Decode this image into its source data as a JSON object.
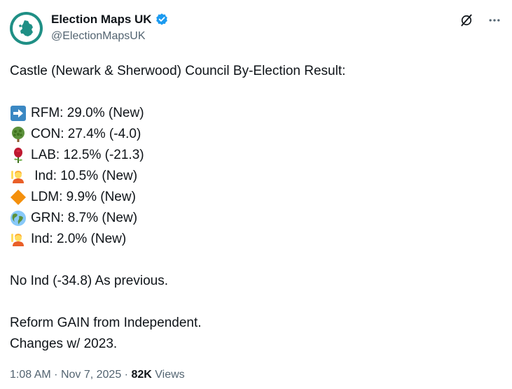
{
  "author": {
    "display_name": "Election Maps UK",
    "handle": "@ElectionMapsUK",
    "verified": true,
    "avatar_icon": "map-logo-icon"
  },
  "top_actions": {
    "grok_icon": "grok-icon",
    "more_icon": "more-icon"
  },
  "tweet": {
    "headline": "Castle (Newark & Sherwood) Council By-Election Result:",
    "results": [
      {
        "icon": "arrow-right-emoji",
        "text": "RFM: 29.0% (New)"
      },
      {
        "icon": "tree-emoji",
        "text": "CON: 27.4% (-4.0)"
      },
      {
        "icon": "rose-emoji",
        "text": "LAB: 12.5% (-21.3)"
      },
      {
        "icon": "person-raising-hand-emoji",
        "text": " Ind: 10.5% (New)"
      },
      {
        "icon": "orange-diamond-emoji",
        "text": "LDM: 9.9% (New)"
      },
      {
        "icon": "globe-emoji",
        "text": "GRN: 8.7% (New)"
      },
      {
        "icon": "person-raising-hand-emoji",
        "text": "Ind: 2.0% (New)"
      }
    ],
    "note": "No Ind (-34.8) As previous.",
    "gain": "Reform GAIN from Independent.",
    "changes": "Changes w/ 2023."
  },
  "meta": {
    "time": "1:08 AM",
    "separator": "·",
    "date": "Nov 7, 2025",
    "views_count": "82K",
    "views_label": "Views"
  },
  "colors": {
    "text": "#0f1419",
    "secondary": "#536471",
    "verified": "#1d9bf0",
    "avatar_ring": "#1f8f85"
  }
}
